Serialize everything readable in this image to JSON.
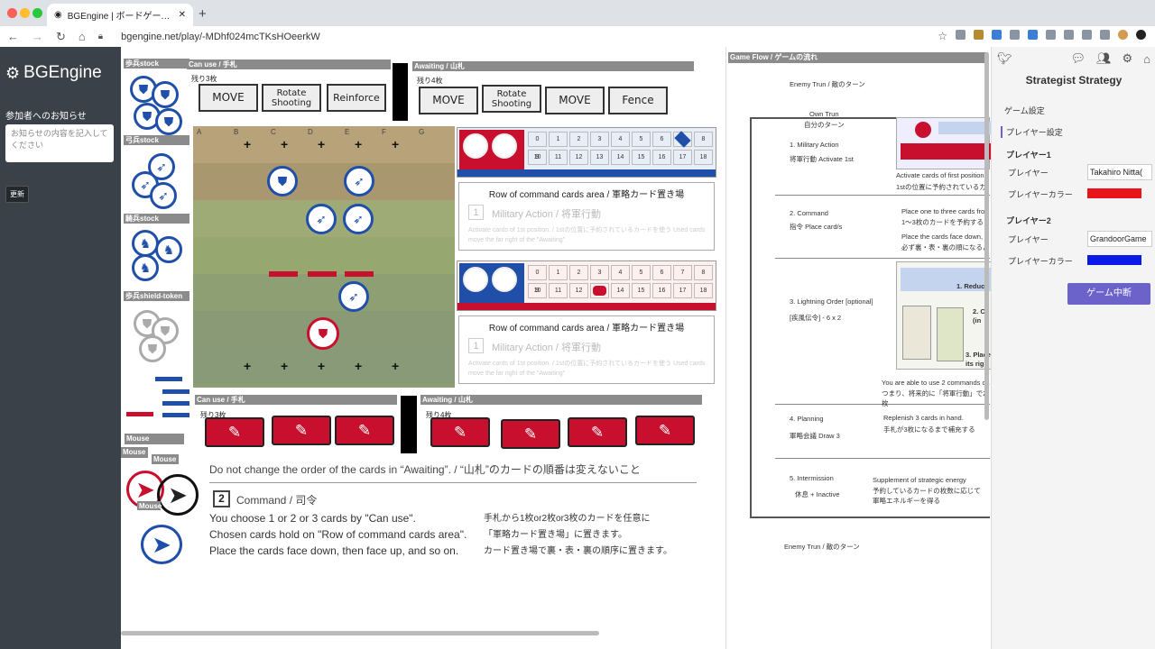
{
  "browser": {
    "tab_title": "BGEngine | ボードゲーム作成支援",
    "url": "bgengine.net/play/-MDhf024mcTKsHOeerkW",
    "controls": {
      "close": "#ff5f57",
      "minimize": "#febc2e",
      "maximize": "#28c840"
    }
  },
  "sidebar": {
    "logo": "BGEngine",
    "notice_heading": "参加者へのお知らせ",
    "notice_placeholder": "お知らせの内容を記入してください",
    "refresh_label": "更新"
  },
  "board": {
    "stocks": [
      "歩兵stock",
      "弓兵stock",
      "騎兵stock",
      "歩兵shield-token"
    ],
    "top_hand": {
      "header": "Can use / 手札",
      "remaining": "残り3枚",
      "cards": [
        "MOVE",
        "Rotate Shooting",
        "Reinforce"
      ]
    },
    "top_awaiting": {
      "header": "Awaiting / 山札",
      "remaining": "残り4枚",
      "cards": [
        "MOVE",
        "Rotate Shooting",
        "MOVE",
        "Fence"
      ]
    },
    "col_labels": [
      "A",
      "B",
      "C",
      "D",
      "E",
      "F",
      "G"
    ],
    "tracker_blue": {
      "numbers": [
        "0",
        "1",
        "2",
        "3",
        "4",
        "5",
        "6",
        "7",
        "8",
        "9",
        "10",
        "11",
        "12",
        "13",
        "14",
        "15",
        "16",
        "17",
        "18"
      ],
      "marker": "7"
    },
    "tracker_red": {
      "numbers": [
        "0",
        "1",
        "2",
        "3",
        "4",
        "5",
        "6",
        "7",
        "8",
        "9",
        "10",
        "11",
        "12",
        "13",
        "14",
        "15",
        "16",
        "17",
        "18"
      ],
      "marker": "13"
    },
    "command_area_title": "Row of command cards area / 軍略カード置き場",
    "command_area_step": "1",
    "command_area_step_title": "Military Action / 将軍行動",
    "command_area_desc": "Activate cards of 1st position. / 1stの位置に予約されているカードを使う  Used cards move the far right of the \"Awaiting\"",
    "bottom_hand": {
      "header": "Can use / 手札",
      "remaining": "残り3枚"
    },
    "bottom_awaiting": {
      "header": "Awaiting / 山札",
      "remaining": "残り4枚"
    },
    "mouse_labels": [
      "Mouse",
      "Mouse",
      "Mouse",
      "Mouse"
    ]
  },
  "rules": {
    "warning": "Do not change the order of the cards in “Awaiting”. / “山札”のカードの順番は変えないこと",
    "step_num": "2",
    "step_title": "Command / 司令",
    "lines_en": [
      "You choose 1 or 2 or  3 cards by \"Can use\".",
      "Chosen cards hold on \"Row of command cards area\".",
      "Place the cards face down, then face up, and so on."
    ],
    "lines_ja": [
      "手札から1枚or2枚or3枚のカードを任意に",
      "「軍略カード置き場」に置きます。",
      "カード置き場で裏・表・裏の順序に置きます。"
    ]
  },
  "flow": {
    "header": "Game Flow / ゲームの流れ",
    "enemy_turn": "Enemy Trun / 敵のターン",
    "own_turn": "Own Trun",
    "own_turn_ja": "自分のターン",
    "phases": [
      {
        "title": "1. Military Action",
        "sub": "将軍行動  Activate  1st",
        "note": "Activate cards of first position",
        "note2": "1stの位置に予約されているカ"
      },
      {
        "title": "2. Command",
        "sub": "指令  Place card/s",
        "note": "Place one to three cards fron",
        "note2": "1〜3枚のカードを予約する",
        "note3": "Place the cards face down,",
        "note4": "必ず裏・表・裏の順になるよ"
      },
      {
        "title": "3. Lightning Order [optional]",
        "sub": "[疾風伝令]  - 6   x 2",
        "note": "You are able to use 2 commands ca",
        "note2": "つまり、将来的に「将軍行動」で2枚"
      },
      {
        "title": "4. Planning",
        "sub": "軍略会議   Draw  3",
        "note": "Replenish 3 cards in hand.",
        "note2": "手札が3枚になるまで補充する"
      },
      {
        "title": "5. Intermission",
        "sub": "休息   + Inactive",
        "note": "Supplement of strategic energy",
        "note2": "予約しているカードの枚数に応じて",
        "note3": "軍略エネルギーを得る"
      }
    ],
    "img_labels": [
      "1. Reduc",
      "2. Cl (in",
      "3. Place its rig"
    ],
    "enemy_turn_bottom": "Enemy Trun / 敵のターン"
  },
  "rightpanel": {
    "title": "Strategist Strategy",
    "game_settings": "ゲーム設定",
    "player_settings": "プレイヤー設定",
    "player1_heading": "プレイヤー1",
    "player2_heading": "プレイヤー2",
    "player_label": "プレイヤー",
    "color_label": "プレイヤーカラー",
    "player1_name": "Takahiro Nitta(",
    "player2_name": "GrandoorGame",
    "player1_color": "#e8141b",
    "player2_color": "#0a1be8",
    "stop_button": "ゲーム中断"
  }
}
